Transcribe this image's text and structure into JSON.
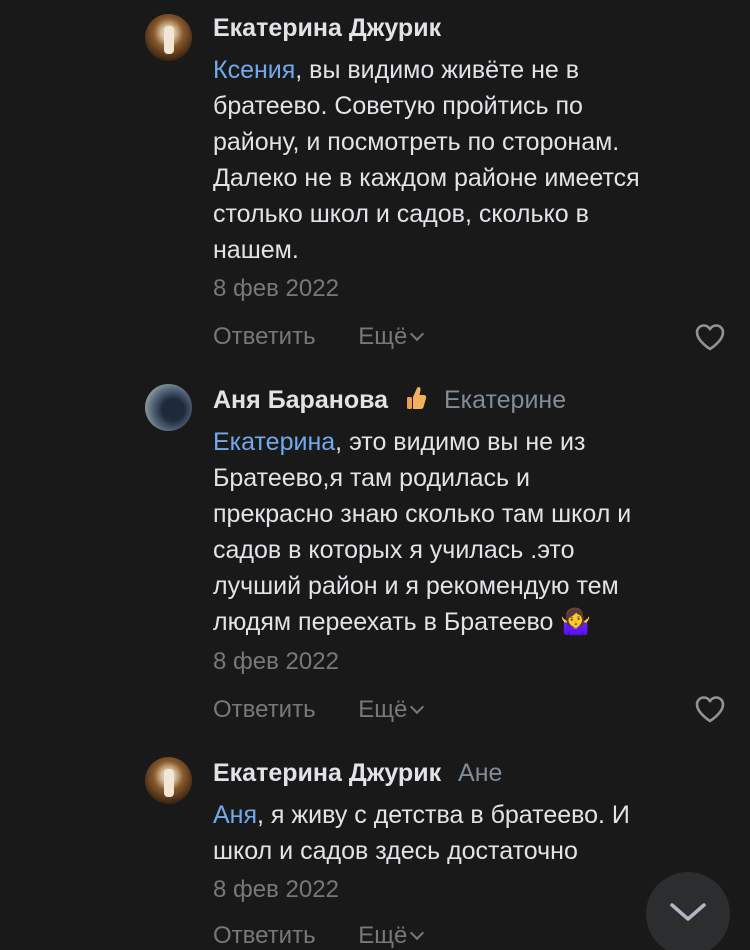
{
  "comments": [
    {
      "author": "Екатерина Джурик",
      "reply_to": "",
      "mention": "Ксения",
      "text": ", вы видимо живёте не в\nбратеево. Советую пройтись по\nрайону, и посмотреть по сторонам.\nДалеко не в каждом районе имеется\nстолько школ и садов, сколько в\nнашем.",
      "emoji": "",
      "date": "8 фев 2022",
      "reply_label": "Ответить",
      "more_label": "Ещё"
    },
    {
      "author": "Аня Баранова",
      "reply_to": "Екатерине",
      "mention": "Екатерина",
      "text": ", это видимо вы не из\nБратеево,я там родилась и\nпрекрасно знаю сколько там школ и\nсадов в которых я училась .это\nлучший район и я рекомендую тем\nлюдям переехать в Братеево ",
      "emoji": "🤷‍♀️",
      "date": "8 фев 2022",
      "reply_label": "Ответить",
      "more_label": "Ещё"
    },
    {
      "author": "Екатерина Джурик",
      "reply_to": "Ане",
      "mention": "Аня",
      "text": ", я живу с детства в братеево. И\nшкол и садов здесь достаточно",
      "emoji": "",
      "date": "8 фев 2022",
      "reply_label": "Ответить",
      "more_label": "Ещё"
    }
  ],
  "icons": {
    "like": "heart-icon",
    "more_chevron": "chevron-down-icon",
    "scroll_down": "chevron-down-icon",
    "badge": "thumbs-up-icon"
  },
  "colors": {
    "background": "#19191a",
    "text": "#e1e3e6",
    "secondary": "#76787a",
    "mention": "#71aaeb"
  }
}
